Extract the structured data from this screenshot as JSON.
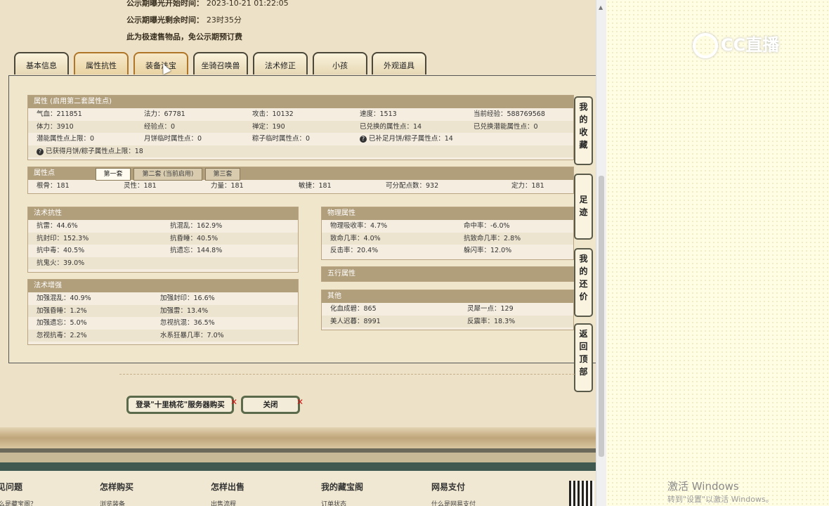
{
  "notice": {
    "start_label": "公示期曝光开始时间：",
    "start_value": "2023-10-21 01:22:05",
    "remain_label": "公示期曝光剩余时间：",
    "remain_value": "23时35分",
    "fast_sale": "此为极速售物品，免公示期预订费"
  },
  "tabs": [
    "基本信息",
    "属性抗性",
    "装备法宝",
    "坐骑召唤兽",
    "法术修正",
    "小孩",
    "外观道具"
  ],
  "attributes": {
    "title": "属性 (启用第二套属性点)",
    "rows": [
      [
        "气血：211851",
        "法力：67781",
        "攻击：10132",
        "速度：1513",
        "当前经验：588769568"
      ],
      [
        "体力：3910",
        "经验点：0",
        "禅定：190",
        "已兑换的属性点：14",
        "已兑换潜能属性点：0"
      ],
      [
        "潜能属性点上限：0",
        "月饼临时属性点：0",
        "粽子临时属性点：0",
        "已补足月饼/粽子属性点：14"
      ],
      [
        "已获得月饼/粽子属性点上限：18"
      ]
    ]
  },
  "points": {
    "title": "属性点",
    "subtabs": [
      "第一套",
      "第二套 (当前启用)",
      "第三套"
    ],
    "values": [
      "根骨：181",
      "灵性：181",
      "力量：181",
      "敏捷：181",
      "可分配点数：932",
      "定力：181"
    ]
  },
  "spell_resist": {
    "title": "法术抗性",
    "rows": [
      [
        "抗雷：44.6%",
        "抗混乱：162.9%"
      ],
      [
        "抗封印：152.3%",
        "抗昏睡：40.5%"
      ],
      [
        "抗中毒：40.5%",
        "抗遗忘：144.8%"
      ],
      [
        "抗鬼火：39.0%",
        ""
      ]
    ]
  },
  "spell_enhance": {
    "title": "法术增强",
    "rows": [
      [
        "加强混乱：40.9%",
        "加强封印：16.6%"
      ],
      [
        "加强昏睡：1.2%",
        "加强雷：13.4%"
      ],
      [
        "加强遗忘：5.0%",
        "忽视抗混：36.5%"
      ],
      [
        "忽视抗毒：2.2%",
        "水系狂暴几率：7.0%"
      ]
    ]
  },
  "physical": {
    "title": "物理属性",
    "rows": [
      [
        "物理吸收率：4.7%",
        "命中率：-6.0%"
      ],
      [
        "致命几率：4.0%",
        "抗致命几率：2.8%"
      ],
      [
        "反击率：20.4%",
        "躲闪率：12.0%"
      ]
    ]
  },
  "five_elements": {
    "title": "五行属性"
  },
  "other": {
    "title": "其他",
    "rows": [
      [
        "化血成碧：865",
        "灵犀一点：129"
      ],
      [
        "美人迟暮：8991",
        "反震率：18.3%"
      ]
    ]
  },
  "side_buttons": [
    "我的收藏",
    "足迹",
    "我的还价",
    "返回顶部"
  ],
  "buttons": {
    "login": "登录\"十里桃花\"服务器购买",
    "close": "关闭"
  },
  "footer": {
    "titles": [
      "见问题",
      "怎样购买",
      "怎样出售",
      "我的藏宝阁",
      "网易支付"
    ],
    "links": [
      "么是藏宝阁？",
      "浏览装备",
      "出售流程",
      "订单状态",
      "什么是网易支付"
    ]
  },
  "overlay": {
    "logo": "CC直播",
    "wm_title": "激活 Windows",
    "wm_sub": "转到\"设置\"以激活 Windows。"
  },
  "colors": {
    "header": "#b19e7b",
    "tab_orange": "#b07628",
    "close_x": "#d01818"
  }
}
